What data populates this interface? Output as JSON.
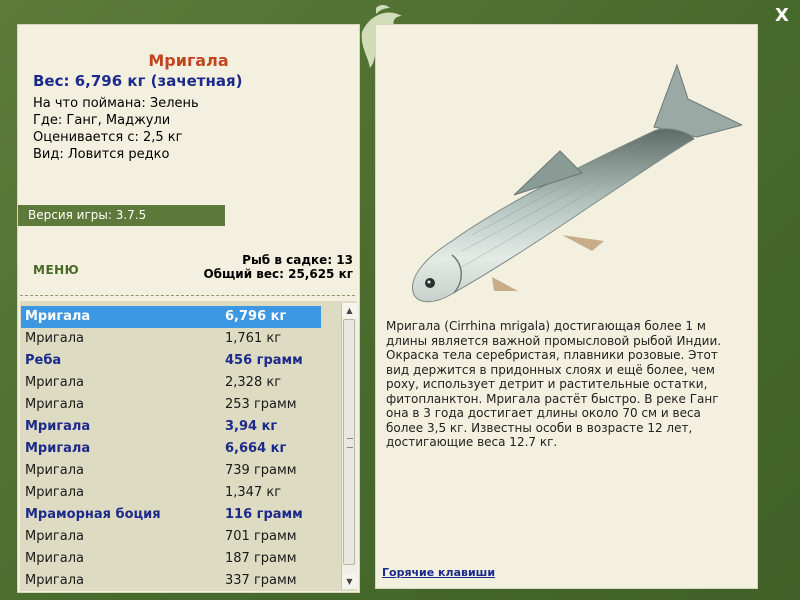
{
  "window": {
    "close_label": "X"
  },
  "fish": {
    "name": "Мригала",
    "weight_line": "Вес: 6,796 кг (зачетная)",
    "info": [
      "На что поймана: Зелень",
      "Где: Ганг, Маджули",
      "Оценивается с: 2,5 кг",
      "Вид: Ловится редко"
    ]
  },
  "version": "Версия игры: 3.7.5",
  "menu_label": "МЕНЮ",
  "stats": {
    "fish_count": "Рыб в садке: 13",
    "total_weight": "Общий вес: 25,625 кг"
  },
  "catch_list": [
    {
      "name": "Мригала",
      "weight": "6,796 кг",
      "state": "selected"
    },
    {
      "name": "Мригала",
      "weight": "1,761 кг",
      "state": "normal"
    },
    {
      "name": "Реба",
      "weight": "456 грамм",
      "state": "trophy"
    },
    {
      "name": "Мригала",
      "weight": "2,328 кг",
      "state": "normal"
    },
    {
      "name": "Мригала",
      "weight": "253 грамм",
      "state": "normal"
    },
    {
      "name": "Мригала",
      "weight": "3,94 кг",
      "state": "trophy"
    },
    {
      "name": "Мригала",
      "weight": "6,664 кг",
      "state": "trophy"
    },
    {
      "name": "Мригала",
      "weight": "739 грамм",
      "state": "normal"
    },
    {
      "name": "Мригала",
      "weight": "1,347 кг",
      "state": "normal"
    },
    {
      "name": "Мраморная боция",
      "weight": "116 грамм",
      "state": "trophy"
    },
    {
      "name": "Мригала",
      "weight": "701 грамм",
      "state": "normal"
    },
    {
      "name": "Мригала",
      "weight": "187 грамм",
      "state": "normal"
    },
    {
      "name": "Мригала",
      "weight": "337 грамм",
      "state": "normal"
    }
  ],
  "description": "Мригала (Cirrhina mrigala) достигающая более 1 м длины является важной промысловой рыбой Индии. Окраска тела серебристая, плавники розовые. Этот вид держится в придонных слоях и ещё более, чем роху, использует детрит и растительные остатки, фитопланктон. Мригала растёт быстро. В реке Ганг она в 3 года достигает длины около 70 см и веса более 3,5 кг. Известны особи в возрасте 12 лет, достигающие веса 12.7 кг.",
  "hotkeys_label": "Горячие клавиши",
  "colors": {
    "frame": "#4e6e32",
    "panel": "#f3f0df",
    "selected_row": "#3d98e3",
    "trophy_text": "#1c2a8c",
    "title": "#c1461f"
  },
  "icons": {
    "close": "close-icon",
    "emblem": "dolphin-emblem-icon",
    "fish": "fish-image"
  }
}
